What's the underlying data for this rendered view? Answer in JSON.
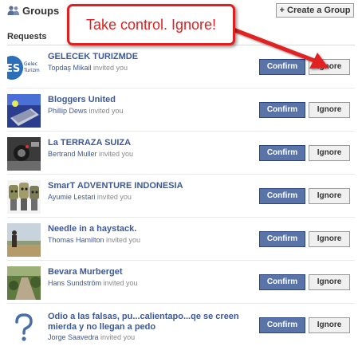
{
  "header": {
    "title": "Groups",
    "create_button": "+ Create a Group"
  },
  "requests_label": "Requests",
  "callout": "Take control. Ignore!",
  "confirm_label": "Confirm",
  "ignore_label": "Ignore",
  "invited_suffix": " invited you",
  "requests": [
    {
      "name": "GELECEK TURIZMDE",
      "inviter": "Topdaş Mikail",
      "thumb": "fes-logo"
    },
    {
      "name": "Bloggers United",
      "inviter": "Phillip Dews",
      "thumb": "laptop-photo"
    },
    {
      "name": "La TERRAZA SUIZA",
      "inviter": "Bertrand Muller",
      "thumb": "camera-photo"
    },
    {
      "name": "SmarT ADVENTURE INDONESIA",
      "inviter": "Ayumie Lestari",
      "thumb": "masks-photo"
    },
    {
      "name": "Needle in a haystack.",
      "inviter": "Thomas Hamilton",
      "thumb": "field-photo"
    },
    {
      "name": "Bevara Murberget",
      "inviter": "Hans Sundström",
      "thumb": "trail-photo"
    },
    {
      "name": "Odio a las falsas, pu...calientapo...qe se creen mierda y no llegan a pedo",
      "inviter": "Jorge Saavedra",
      "thumb": "question-mark"
    }
  ]
}
